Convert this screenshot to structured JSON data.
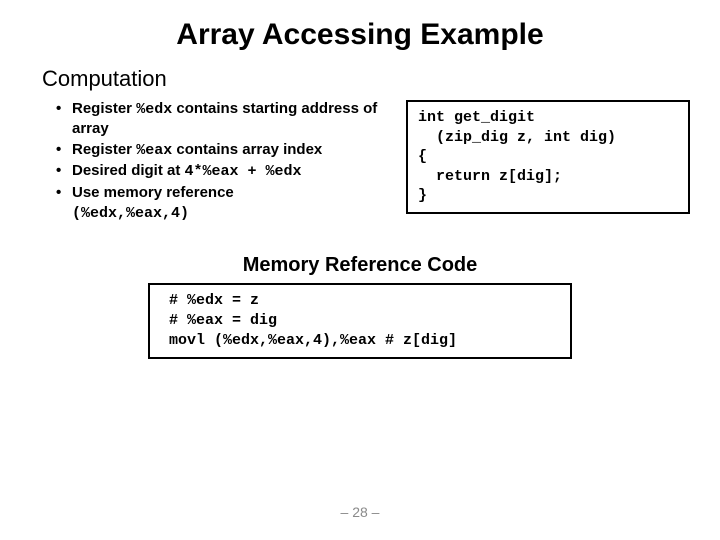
{
  "title": "Array Accessing Example",
  "computation": {
    "heading": "Computation",
    "b1_pre": "Register ",
    "b1_code": "%edx",
    "b1_post": " contains starting address of array",
    "b2_pre": "Register ",
    "b2_code": "%eax",
    "b2_post": " contains array index",
    "b3_pre": "Desired digit at ",
    "b3_code": "4*%eax + %edx",
    "b4": "Use memory reference",
    "b4_sub": "(%edx,%eax,4)"
  },
  "code_box": "int get_digit\n  (zip_dig z, int dig)\n{\n  return z[dig];\n}",
  "mem": {
    "heading": "Memory Reference Code",
    "code": " # %edx = z\n # %eax = dig\n movl (%edx,%eax,4),%eax # z[dig]"
  },
  "page_number": "– 28 –"
}
